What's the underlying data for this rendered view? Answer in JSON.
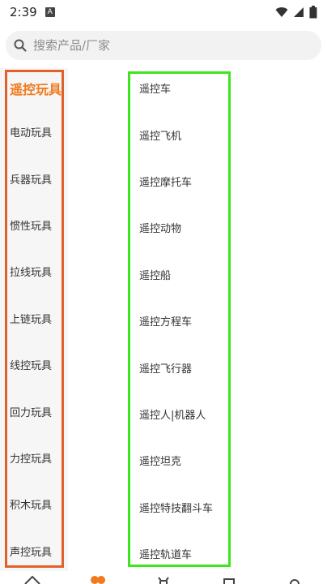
{
  "status_bar": {
    "time": "2:39",
    "notification_icon": "A"
  },
  "search": {
    "placeholder": "搜索产品/厂家"
  },
  "categories": [
    {
      "label": "遥控玩具",
      "active": true
    },
    {
      "label": "电动玩具"
    },
    {
      "label": "兵器玩具"
    },
    {
      "label": "惯性玩具"
    },
    {
      "label": "拉线玩具"
    },
    {
      "label": "上链玩具"
    },
    {
      "label": "线控玩具"
    },
    {
      "label": "回力玩具"
    },
    {
      "label": "力控玩具"
    },
    {
      "label": "积木玩具"
    },
    {
      "label": "声控玩具"
    }
  ],
  "subcategories": [
    {
      "label": "遥控车"
    },
    {
      "label": "遥控飞机"
    },
    {
      "label": "遥控摩托车"
    },
    {
      "label": "遥控动物"
    },
    {
      "label": "遥控船"
    },
    {
      "label": "遥控方程车"
    },
    {
      "label": "遥控飞行器"
    },
    {
      "label": "遥控人|机器人"
    },
    {
      "label": "遥控坦克"
    },
    {
      "label": "遥控特技翻斗车"
    },
    {
      "label": "遥控轨道车"
    }
  ],
  "colors": {
    "accent": "#f07a1d",
    "left_frame": "#e2602a",
    "right_frame": "#3ee51f"
  },
  "bottom_nav": {
    "icons": [
      "home-icon",
      "category-icon",
      "cart-icon",
      "message-icon",
      "profile-icon"
    ]
  }
}
